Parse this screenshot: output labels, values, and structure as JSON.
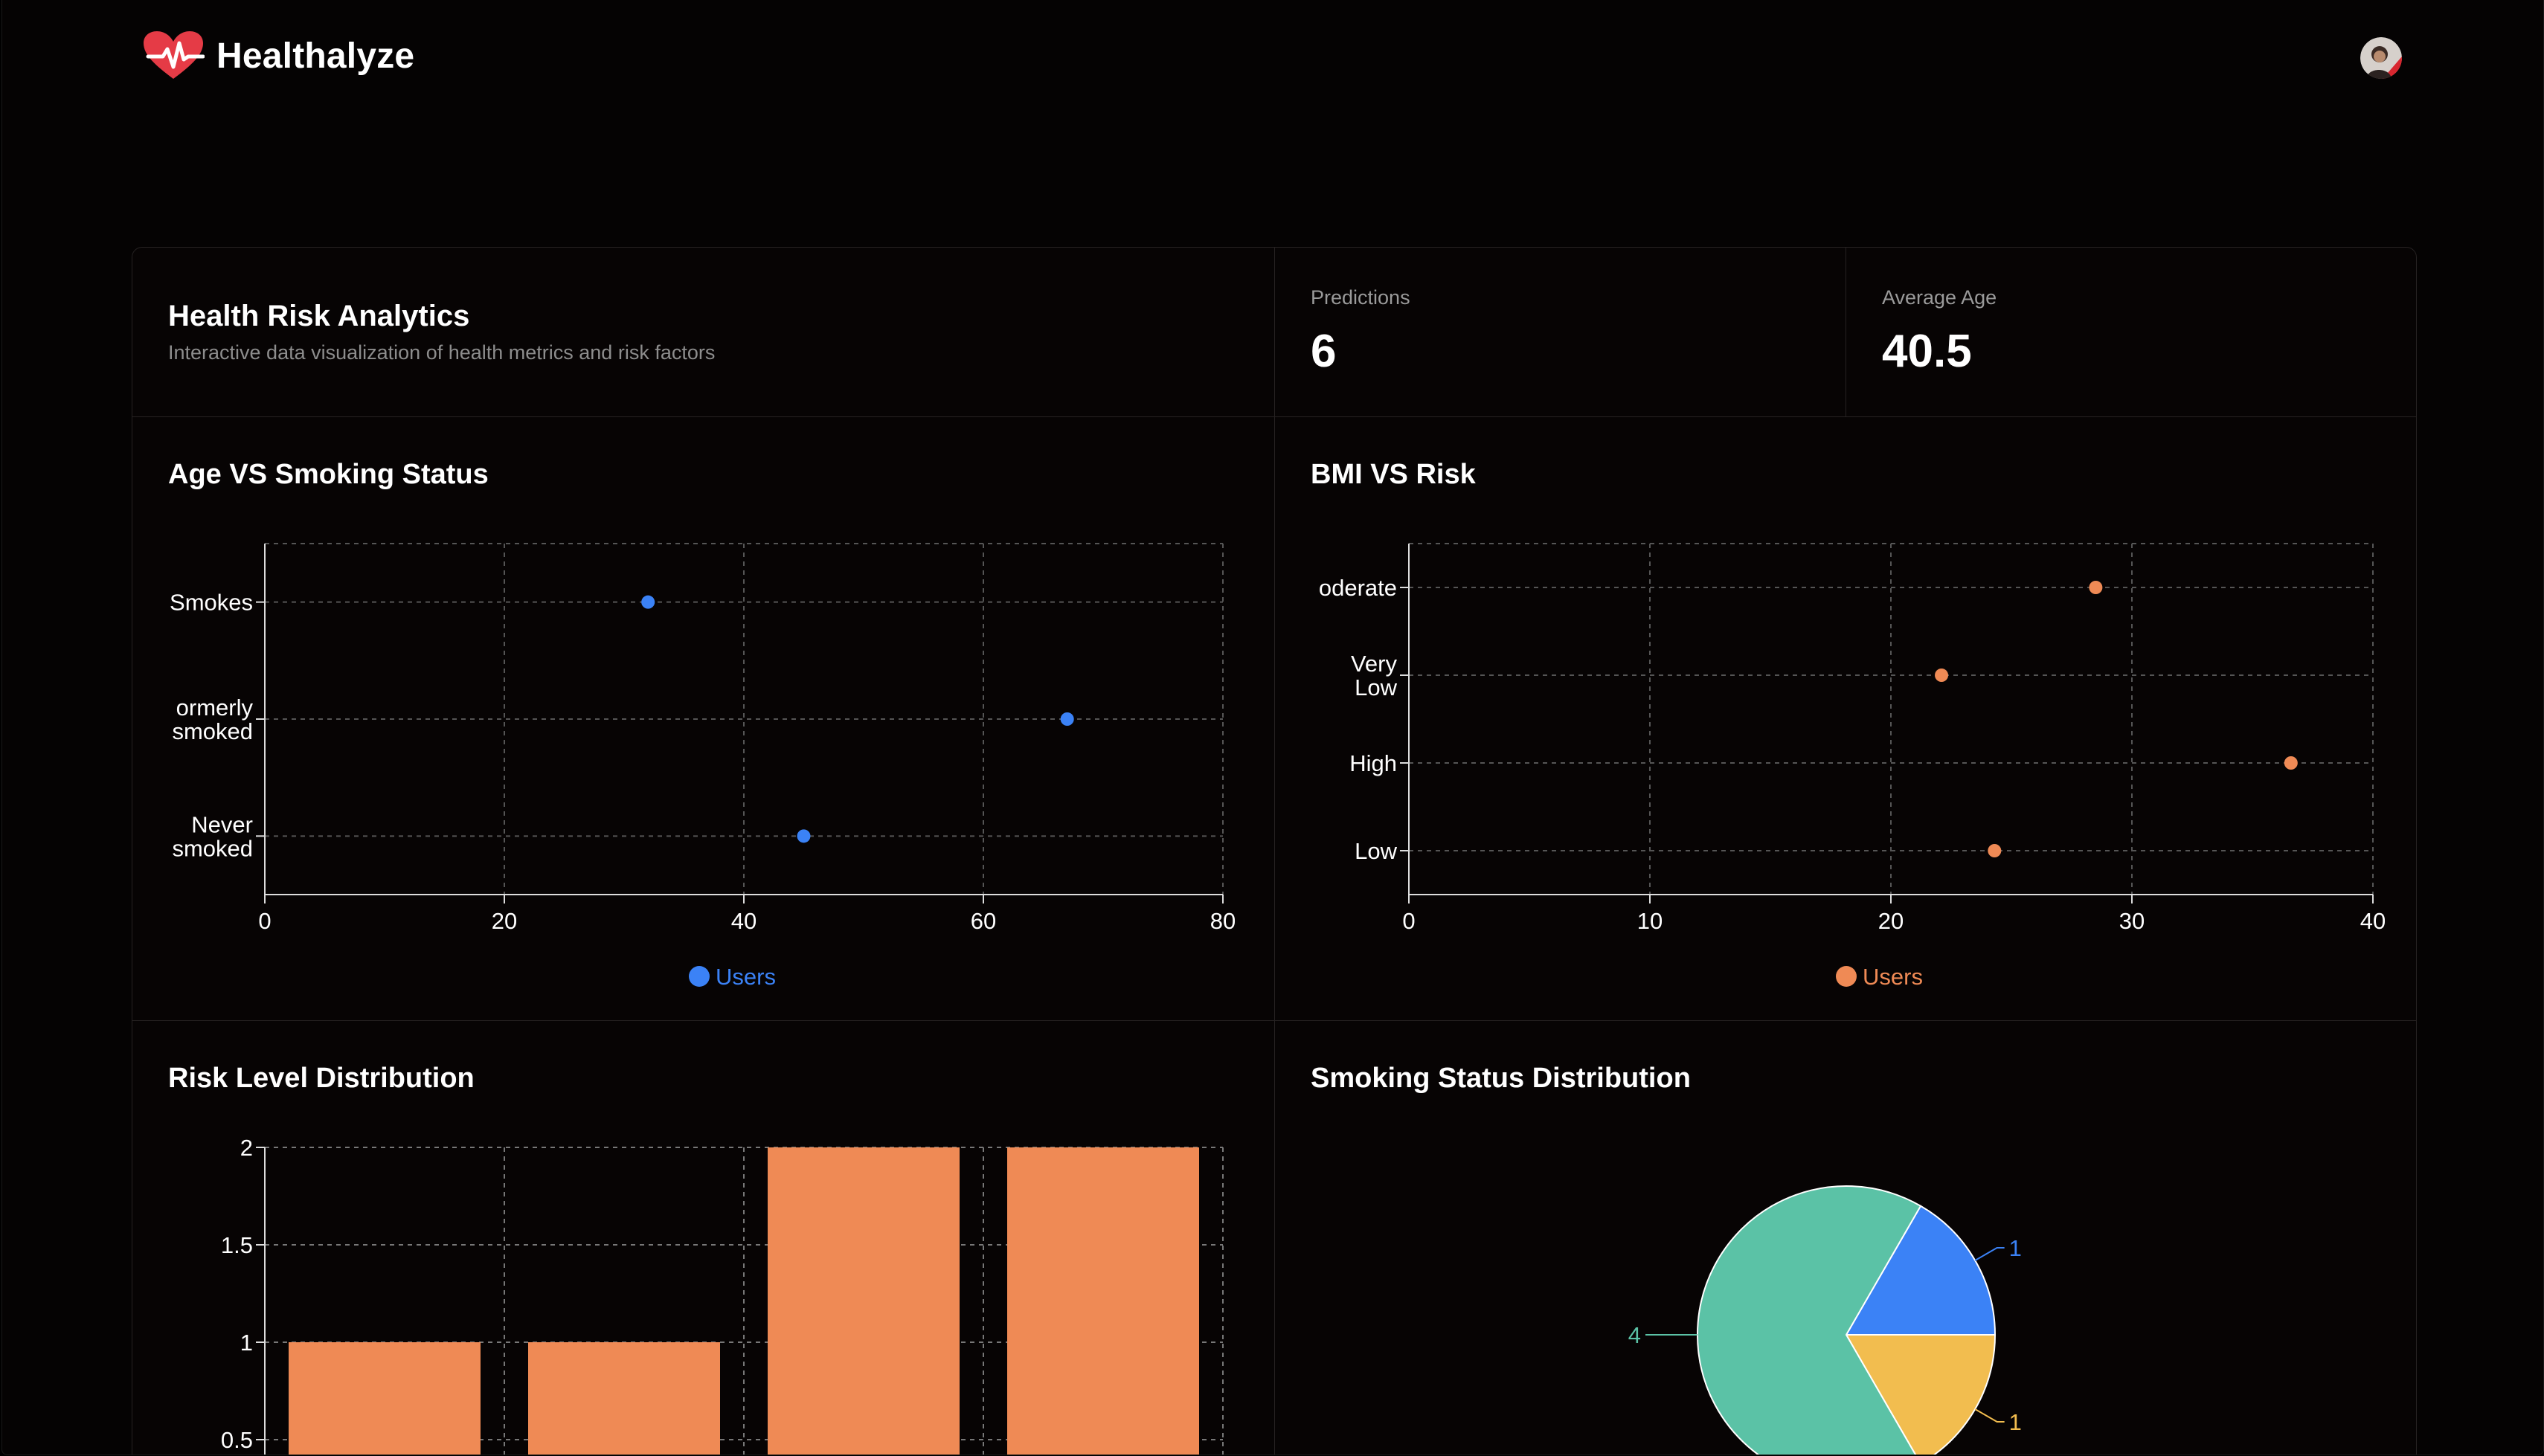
{
  "app": {
    "brand": "Healthalyze"
  },
  "header": {
    "title": "Health Risk Analytics",
    "subtitle": "Interactive data visualization of health metrics and risk factors"
  },
  "stats": [
    {
      "label": "Predictions",
      "value": "6"
    },
    {
      "label": "Average Age",
      "value": "40.5"
    }
  ],
  "colors": {
    "blue": "#3b82f6",
    "orange": "#ef8a55",
    "green": "#5bc2a6",
    "yellow": "#f2bd4f",
    "logo_red": "#e53b46"
  },
  "chart_data": [
    {
      "type": "scatter",
      "title": "Age VS Smoking Status",
      "x_ticks": [
        "0",
        "20",
        "40",
        "60",
        "80"
      ],
      "xlim": [
        0,
        80
      ],
      "categories": [
        "Smokes",
        "Formerly smoked",
        "Never smoked"
      ],
      "y_tick_lines": [
        [
          "Smokes"
        ],
        [
          "ormerly",
          "smoked"
        ],
        [
          "Never",
          "smoked"
        ]
      ],
      "series": [
        {
          "name": "Users",
          "points": [
            {
              "x": 32,
              "y": "Smokes"
            },
            {
              "x": 67,
              "y": "Formerly smoked"
            },
            {
              "x": 45,
              "y": "Never smoked"
            }
          ]
        }
      ],
      "grid": true,
      "legend": "bottom-center"
    },
    {
      "type": "scatter",
      "title": "BMI VS Risk",
      "x_ticks": [
        "0",
        "10",
        "20",
        "30",
        "40"
      ],
      "xlim": [
        0,
        40
      ],
      "categories": [
        "Moderate",
        "Very Low",
        "High",
        "Low"
      ],
      "y_tick_lines": [
        [
          "oderate"
        ],
        [
          "Very",
          "Low"
        ],
        [
          "High"
        ],
        [
          "Low"
        ]
      ],
      "series": [
        {
          "name": "Users",
          "points": [
            {
              "x": 28.5,
              "y": "Moderate"
            },
            {
              "x": 22.1,
              "y": "Very Low"
            },
            {
              "x": 36.6,
              "y": "High"
            },
            {
              "x": 24.3,
              "y": "Low"
            }
          ]
        }
      ],
      "grid": true,
      "legend": "bottom-center"
    },
    {
      "type": "bar",
      "title": "Risk Level Distribution",
      "y_ticks": [
        "2",
        "1.5",
        "1",
        "0.5"
      ],
      "ylim": [
        0,
        2
      ],
      "values": [
        1,
        1,
        2,
        2
      ],
      "grid": true
    },
    {
      "type": "pie",
      "title": "Smoking Status Distribution",
      "slices": [
        {
          "value": 1,
          "label": "1",
          "color": "#3b82f6"
        },
        {
          "value": 1,
          "label": "1",
          "color": "#f2bd4f"
        },
        {
          "value": 4,
          "label": "4",
          "color": "#5bc2a6"
        }
      ]
    }
  ]
}
